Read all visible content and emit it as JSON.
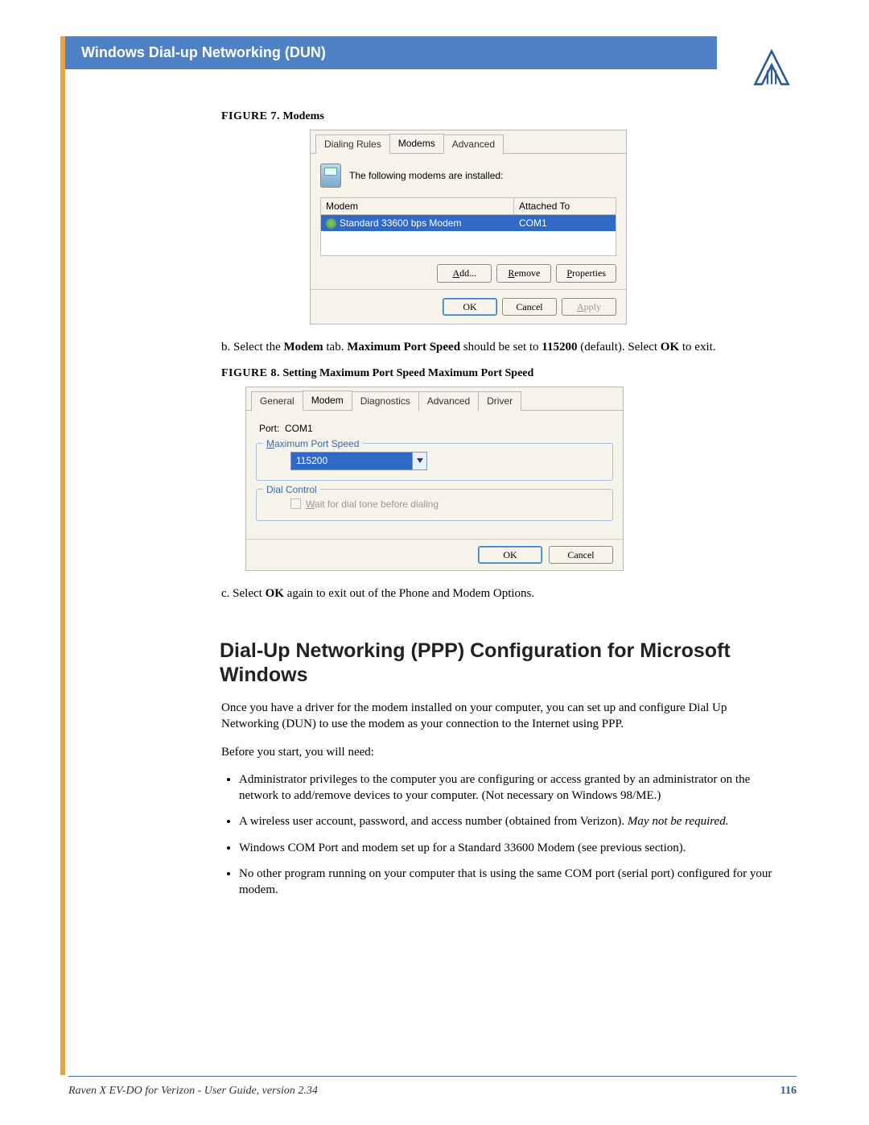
{
  "header": {
    "title": "Windows Dial-up Networking (DUN)"
  },
  "fig7": {
    "caption_prefix": "FIGURE 7.",
    "caption": "Modems",
    "tabs": [
      "Dialing Rules",
      "Modems",
      "Advanced"
    ],
    "message": "The following modems are installed:",
    "col1": "Modem",
    "col2": "Attached To",
    "row_modem": "Standard 33600 bps Modem",
    "row_port": "COM1",
    "btn_add": "Add...",
    "btn_remove": "Remove",
    "btn_props": "Properties",
    "btn_ok": "OK",
    "btn_cancel": "Cancel",
    "btn_apply": "Apply"
  },
  "step_b": {
    "pre": "b. Select the ",
    "modem": "Modem",
    "mid1": " tab.  ",
    "mps": "Maximum Port Speed",
    "mid2": " should be set to ",
    "val": "115200",
    "mid3": " (default).  Select ",
    "ok": "OK",
    "post": " to exit."
  },
  "fig8": {
    "caption_prefix": "FIGURE 8.",
    "caption": "Setting Maximum Port Speed Maximum Port Speed",
    "tabs": [
      "General",
      "Modem",
      "Diagnostics",
      "Advanced",
      "Driver"
    ],
    "port_label": "Port:",
    "port_value": "COM1",
    "group1": "Maximum Port Speed",
    "speed": "115200",
    "group2": "Dial Control",
    "chk_label": "Wait for dial tone before dialing",
    "btn_ok": "OK",
    "btn_cancel": "Cancel"
  },
  "step_c": {
    "pre": "c. Select ",
    "ok": "OK",
    "post": " again to exit out of the Phone and Modem Options."
  },
  "section": {
    "heading": "Dial-Up Networking (PPP) Configuration for Microsoft Windows"
  },
  "body": {
    "p1": "Once you have a driver for the modem installed on your computer, you can set up and configure Dial Up Networking (DUN) to use the modem as your connection to the Internet using PPP.",
    "p2": "Before you start, you will need:",
    "b1": "Administrator privileges to the computer you are configuring or access granted by an administrator on the network to add/remove devices to your computer. (Not necessary on Windows 98/ME.)",
    "b2_pre": "A wireless user account, password, and access number (obtained from Verizon). ",
    "b2_it": "May not be required.",
    "b3": "Windows COM Port and modem set up for a Standard 33600 Modem (see previous section).",
    "b4": "No other program running on your computer that is using the same COM port (serial port) configured for your modem."
  },
  "footer": {
    "text": "Raven X EV-DO for Verizon - User Guide, version 2.34",
    "page": "116"
  }
}
